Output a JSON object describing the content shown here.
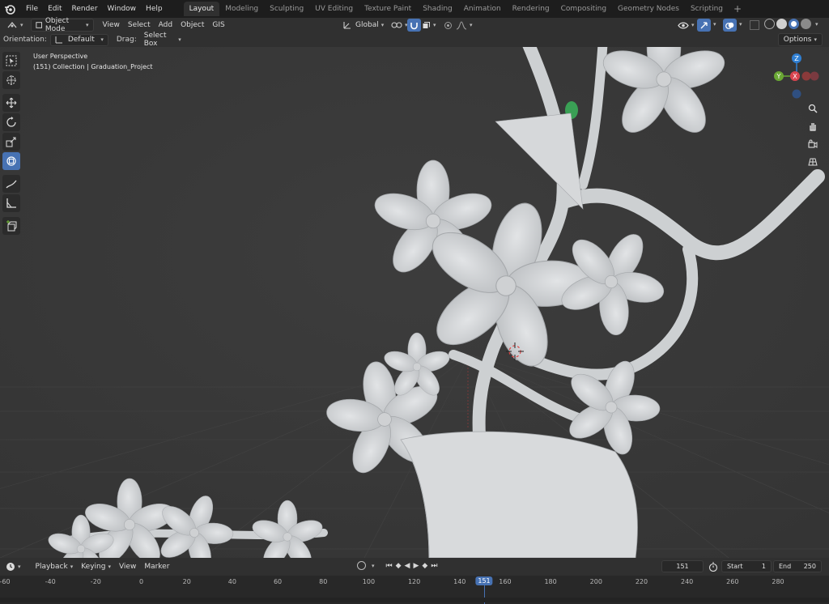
{
  "menubar": {
    "items": [
      "File",
      "Edit",
      "Render",
      "Window",
      "Help"
    ]
  },
  "workspace_tabs": [
    "Layout",
    "Modeling",
    "Sculpting",
    "UV Editing",
    "Texture Paint",
    "Shading",
    "Animation",
    "Rendering",
    "Compositing",
    "Geometry Nodes",
    "Scripting"
  ],
  "active_workspace": "Layout",
  "viewport_header": {
    "mode": "Object Mode",
    "menus": [
      "View",
      "Select",
      "Add",
      "Object",
      "GIS"
    ],
    "transform_orientation": "Global"
  },
  "tool_settings": {
    "orientation_label": "Orientation:",
    "orientation_value": "Default",
    "drag_label": "Drag:",
    "drag_value": "Select Box",
    "options_label": "Options"
  },
  "viewport_overlay": {
    "view_name": "User Perspective",
    "frame_info": "(151) Collection | Graduation_Project"
  },
  "gizmo": {
    "axes": [
      "Z",
      "Y",
      "X"
    ],
    "colors": {
      "x": "#d9444f",
      "y": "#6aa834",
      "z": "#2f7fd3"
    }
  },
  "toolbar_tools": [
    "select-box",
    "cursor",
    "move",
    "rotate",
    "scale",
    "transform",
    "annotate",
    "measure",
    "add-cube"
  ],
  "timeline": {
    "menus": [
      "Playback",
      "Keying",
      "View",
      "Marker"
    ],
    "current_frame": "151",
    "start_label": "Start",
    "start_value": "1",
    "end_label": "End",
    "end_value": "250",
    "ruler_ticks": [
      "-60",
      "-40",
      "-20",
      "0",
      "20",
      "40",
      "60",
      "80",
      "100",
      "120",
      "140",
      "160",
      "180",
      "200",
      "220",
      "240",
      "260",
      "280"
    ],
    "marker_label": "151"
  },
  "colors": {
    "accent": "#4772b3",
    "viewport_bg": "#3b3b3b",
    "header_bg": "#303030",
    "mesh": "#d4d6d8",
    "green_detail": "#3aa055"
  }
}
